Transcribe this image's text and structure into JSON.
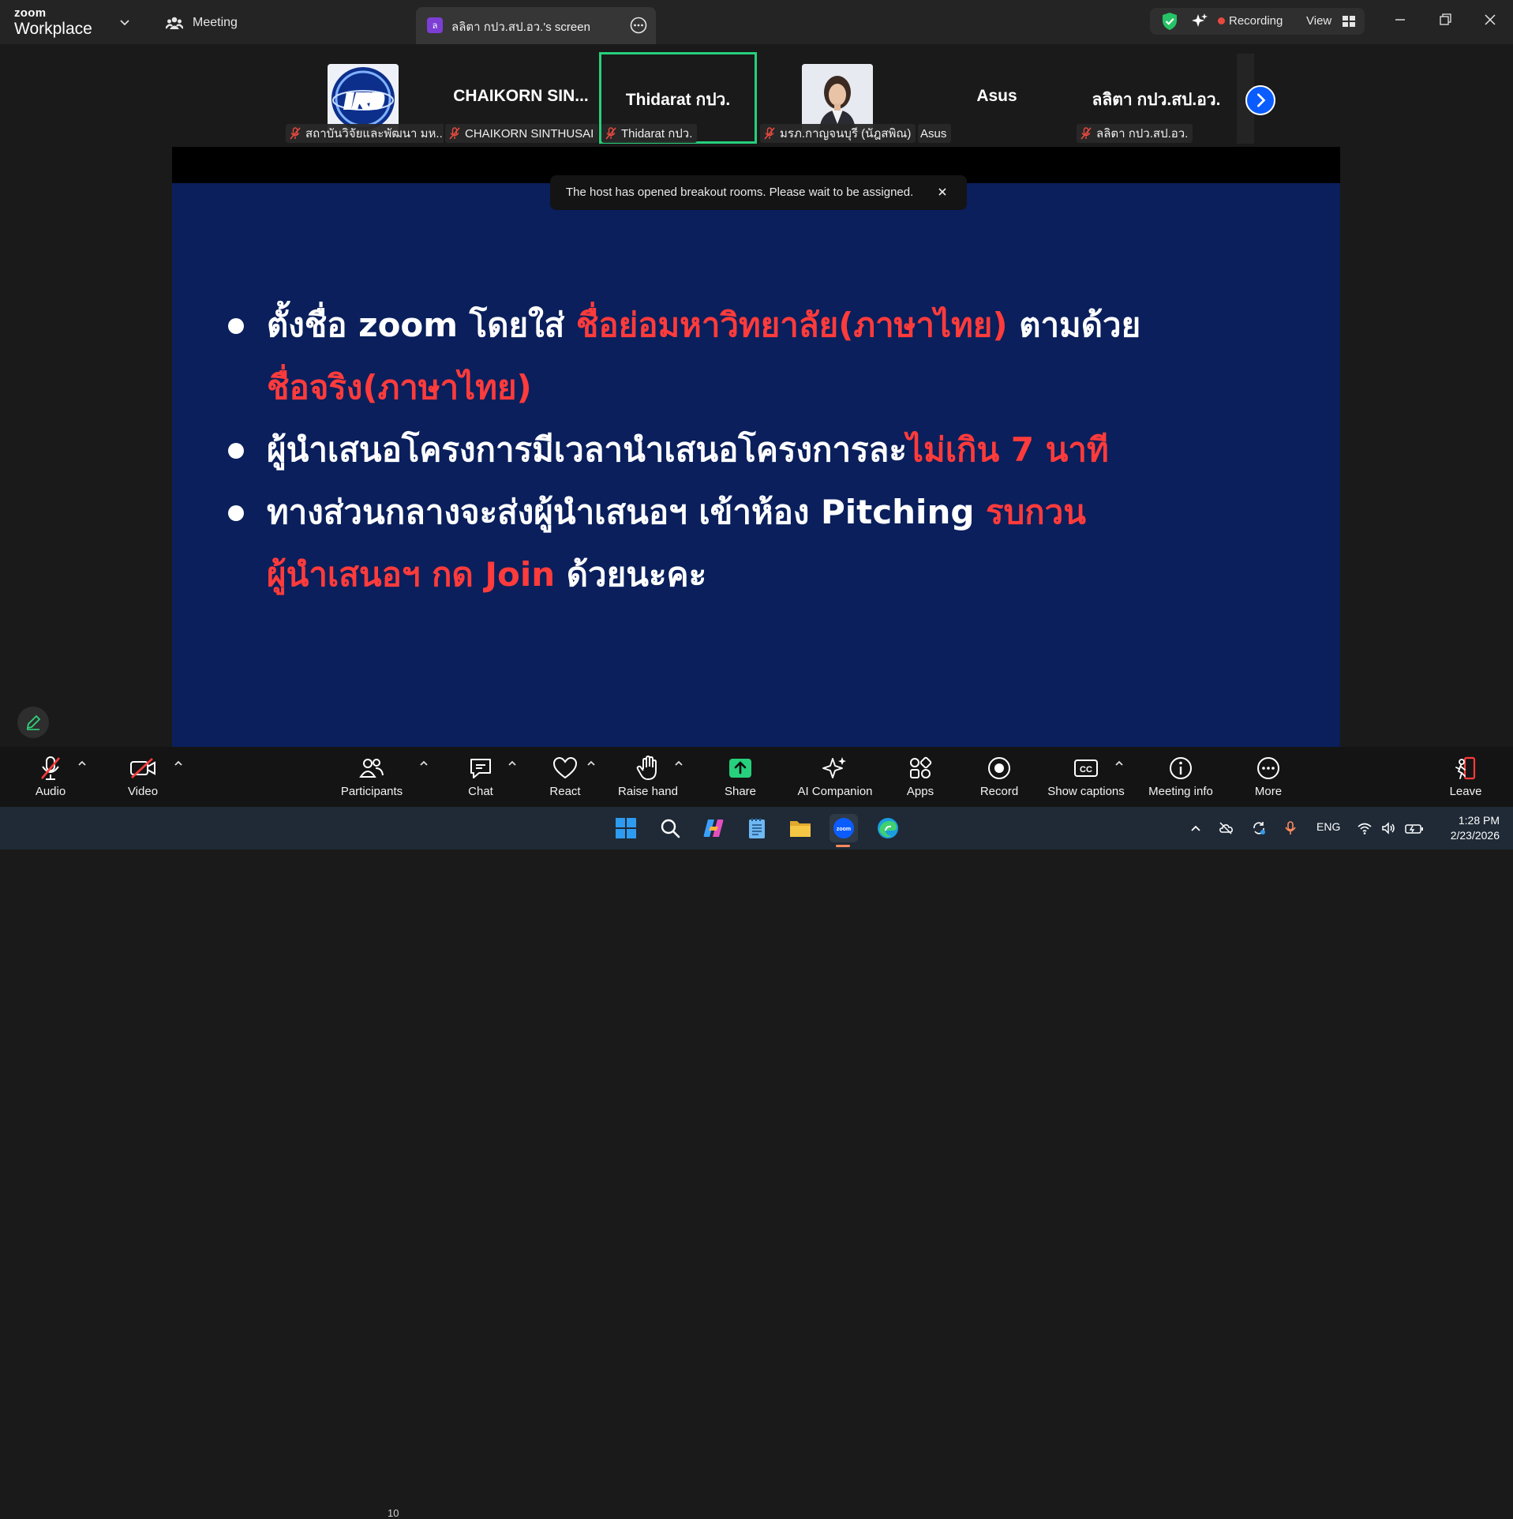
{
  "app": {
    "brand_top": "zoom",
    "brand_bottom": "Workplace"
  },
  "tabs": {
    "meeting_label": "Meeting",
    "screen_avatar": "ล",
    "screen_label": "ลลิตา กปว.สป.อว.'s screen"
  },
  "status": {
    "recording_label": "Recording",
    "view_label": "View",
    "accent": "#26d07c"
  },
  "participants": [
    {
      "name_big": "",
      "tag": "สถาบันวิจัยและพัฒนา มห...",
      "has_photo": "logo"
    },
    {
      "name_big": "CHAIKORN  SIN...",
      "tag": "CHAIKORN SINTHUSAI"
    },
    {
      "name_big": "Thidarat กปว.",
      "tag": "Thidarat กปว.",
      "active": true
    },
    {
      "name_big": "",
      "tag": "มรภ.กาญจนบุรี (นัฎสพิณ)",
      "has_photo": "person"
    },
    {
      "name_big": "Asus",
      "tag": "Asus"
    },
    {
      "name_big": "ลลิตา กปว.สป.อว.",
      "tag": "ลลิตา กปว.สป.อว."
    }
  ],
  "toast": {
    "text": "The host has opened breakout rooms. Please wait to be assigned."
  },
  "slide": {
    "line1_a": "ตั้งชื่อ zoom โดยใส่ ",
    "line1_b": "ชื่อย่อมหาวิทยาลัย(ภาษาไทย)",
    "line1_c": " ตามด้วย",
    "line2": "ชื่อจริง(ภาษาไทย)",
    "line3_a": "ผู้นำเสนอโครงการมีเวลานำเสนอโครงการละ",
    "line3_b": "ไม่เกิน 7 นาที",
    "line4_a": "ทางส่วนกลางจะส่งผู้นำเสนอฯ เข้าห้อง Pitching ",
    "line4_b": "รบกวน",
    "line5_a": "ผู้นำเสนอฯ กด Join",
    "line5_b": " ด้วยนะคะ"
  },
  "toolbar": {
    "audio": "Audio",
    "video": "Video",
    "participants": "Participants",
    "participants_count": "10",
    "chat": "Chat",
    "react": "React",
    "raise_hand": "Raise hand",
    "share": "Share",
    "ai_companion": "AI Companion",
    "apps": "Apps",
    "record": "Record",
    "show_captions": "Show captions",
    "meeting_info": "Meeting info",
    "more": "More",
    "leave": "Leave"
  },
  "taskbar": {
    "apps": [
      "start-icon",
      "search-icon",
      "copilot-icon",
      "notepad-icon",
      "file-explorer-icon",
      "zoom-icon",
      "edge-icon"
    ],
    "language": "ENG",
    "time": "1:28 PM",
    "date": "2/23/2026"
  }
}
